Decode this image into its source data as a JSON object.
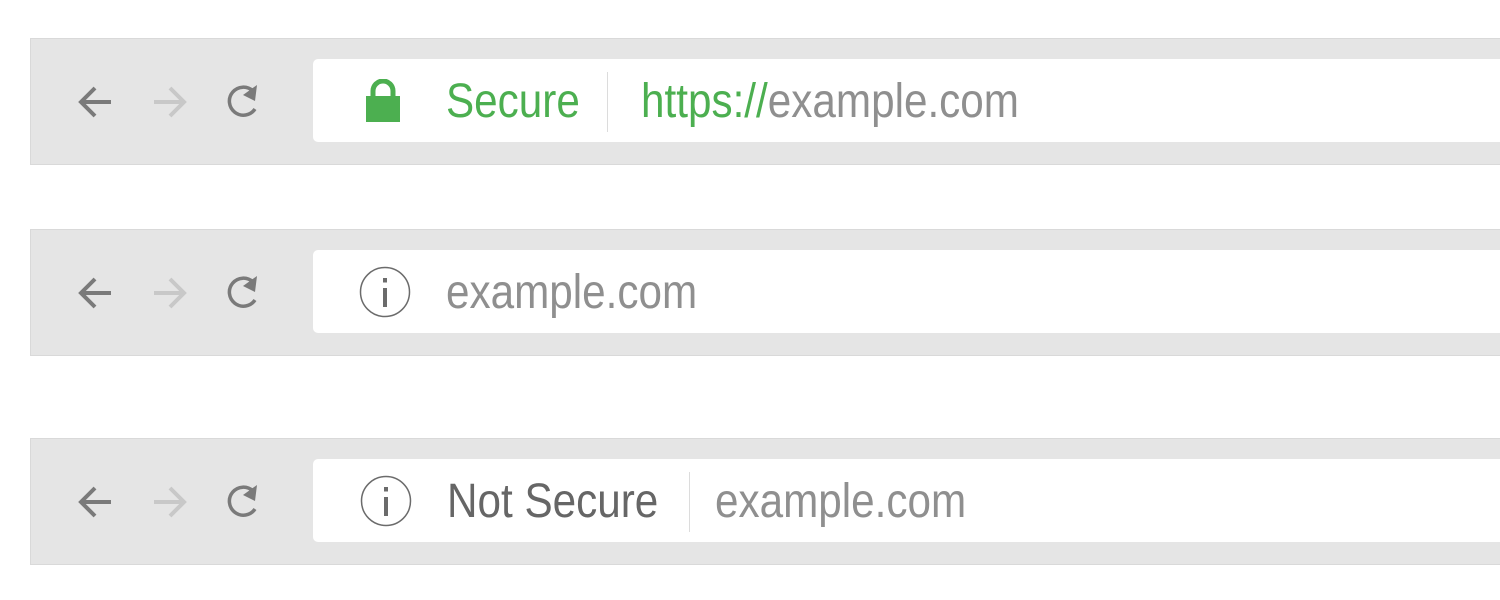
{
  "colors": {
    "secure_green": "#4caf50",
    "icon_gray": "#7a7a7a",
    "disabled_gray": "#c8c8c8",
    "url_gray": "#8f8f8f",
    "bar_bg": "#e5e5e5"
  },
  "bars": [
    {
      "state": "secure",
      "security_label": "Secure",
      "scheme": "https://",
      "host": "example.com",
      "icon": "lock-icon"
    },
    {
      "state": "neutral",
      "host": "example.com",
      "icon": "info-icon"
    },
    {
      "state": "not-secure",
      "security_label": "Not Secure",
      "host": "example.com",
      "icon": "info-icon"
    }
  ]
}
